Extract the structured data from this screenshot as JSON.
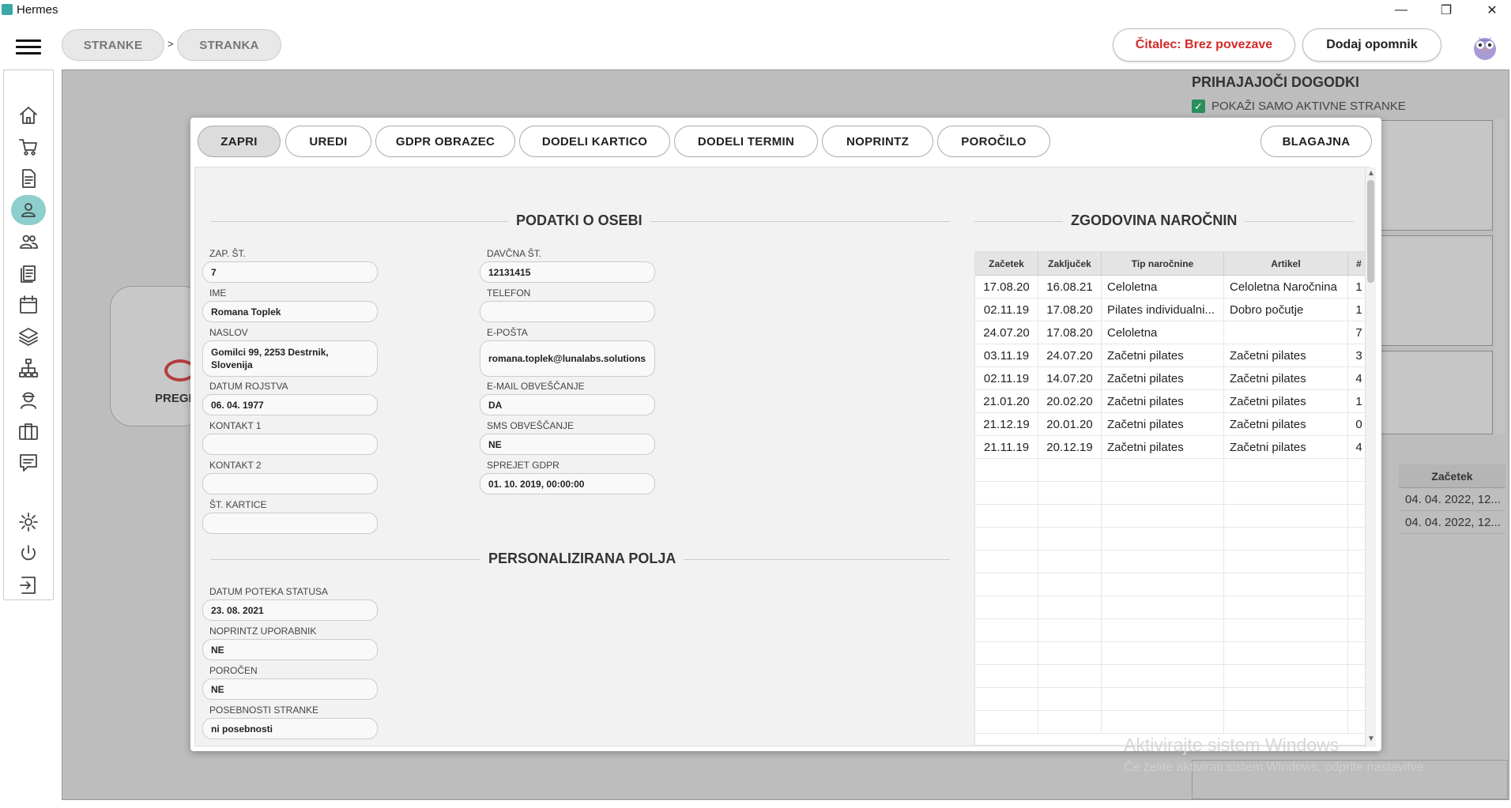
{
  "window": {
    "title": "Hermes",
    "controls": {
      "minimize": "—",
      "maximize": "❐",
      "close": "✕"
    }
  },
  "breadcrumb": {
    "items": [
      "STRANKE",
      "STRANKA"
    ],
    "separator": ">"
  },
  "header": {
    "reader_status": "Čitalec: Brez povezave",
    "reader_color": "#d42a2a",
    "add_reminder": "Dodaj opomnik"
  },
  "sidebar": {
    "items": [
      "home",
      "cart",
      "document",
      "person",
      "people",
      "list",
      "calendar",
      "layers",
      "network",
      "worker",
      "briefcase",
      "chat",
      "settings",
      "power",
      "logout"
    ],
    "active": "person",
    "accent": "#8ccfcd"
  },
  "background": {
    "card_label": "PREGL",
    "upcoming_title": "PRIHAJAJOČI DOGODKI",
    "upcoming_checkbox": "POKAŽI SAMO AKTIVNE STRANKE",
    "table_header": "Začetek",
    "table_rows": [
      "04. 04. 2022, 12...",
      "04. 04. 2022, 12..."
    ],
    "watermark_title": "Aktivirajte sistem Windows",
    "watermark_sub": "Če želite aktivirati sistem Windows, odprite nastavitve."
  },
  "modal": {
    "tabs": [
      "ZAPRI",
      "UREDI",
      "GDPR OBRAZEC",
      "DODELI KARTICO",
      "DODELI TERMIN",
      "NOPRINTZ",
      "POROČILO"
    ],
    "cash_button": "BLAGAJNA",
    "person_section_title": "PODATKI O OSEBI",
    "custom_section_title": "PERSONALIZIRANA POLJA",
    "history_title": "ZGODOVINA NAROČNIN",
    "left_fields": [
      {
        "label": "ZAP. ŠT.",
        "value": "7"
      },
      {
        "label": "IME",
        "value": "Romana Toplek"
      },
      {
        "label": "NASLOV",
        "value": "Gomilci 99, 2253 Destrnik, Slovenija"
      },
      {
        "label": "DATUM ROJSTVA",
        "value": "06. 04. 1977"
      },
      {
        "label": "KONTAKT 1",
        "value": ""
      },
      {
        "label": "KONTAKT 2",
        "value": ""
      },
      {
        "label": "ŠT. KARTICE",
        "value": ""
      }
    ],
    "right_fields": [
      {
        "label": "DAVČNA ŠT.",
        "value": "12131415"
      },
      {
        "label": "TELEFON",
        "value": ""
      },
      {
        "label": "E-POŠTA",
        "value": "romana.toplek@lunalabs.solutions"
      },
      {
        "label": "E-MAIL OBVEŠČANJE",
        "value": "DA"
      },
      {
        "label": "SMS OBVEŠČANJE",
        "value": "NE"
      },
      {
        "label": "SPREJET GDPR",
        "value": "01. 10. 2019, 00:00:00"
      }
    ],
    "custom_fields": [
      {
        "label": "DATUM POTEKA STATUSA",
        "value": "23. 08. 2021"
      },
      {
        "label": "NOPRINTZ UPORABNIK",
        "value": "NE"
      },
      {
        "label": "POROČEN",
        "value": "NE"
      },
      {
        "label": "POSEBNOSTI STRANKE",
        "value": "ni posebnosti"
      }
    ],
    "history_columns": [
      "Začetek",
      "Zaključek",
      "Tip naročnine",
      "Artikel",
      "#"
    ],
    "history_rows": [
      [
        "17.08.20",
        "16.08.21",
        "Celoletna",
        "Celoletna Naročnina",
        "1"
      ],
      [
        "02.11.19",
        "17.08.20",
        "Pilates individualni...",
        "Dobro počutje",
        "1"
      ],
      [
        "24.07.20",
        "17.08.20",
        "Celoletna",
        "",
        "7"
      ],
      [
        "03.11.19",
        "24.07.20",
        "Začetni pilates",
        "Začetni pilates",
        "3"
      ],
      [
        "02.11.19",
        "14.07.20",
        "Začetni pilates",
        "Začetni pilates",
        "4"
      ],
      [
        "21.01.20",
        "20.02.20",
        "Začetni pilates",
        "Začetni pilates",
        "1"
      ],
      [
        "21.12.19",
        "20.01.20",
        "Začetni pilates",
        "Začetni pilates",
        "0"
      ],
      [
        "21.11.19",
        "20.12.19",
        "Začetni pilates",
        "Začetni pilates",
        "4"
      ]
    ]
  }
}
